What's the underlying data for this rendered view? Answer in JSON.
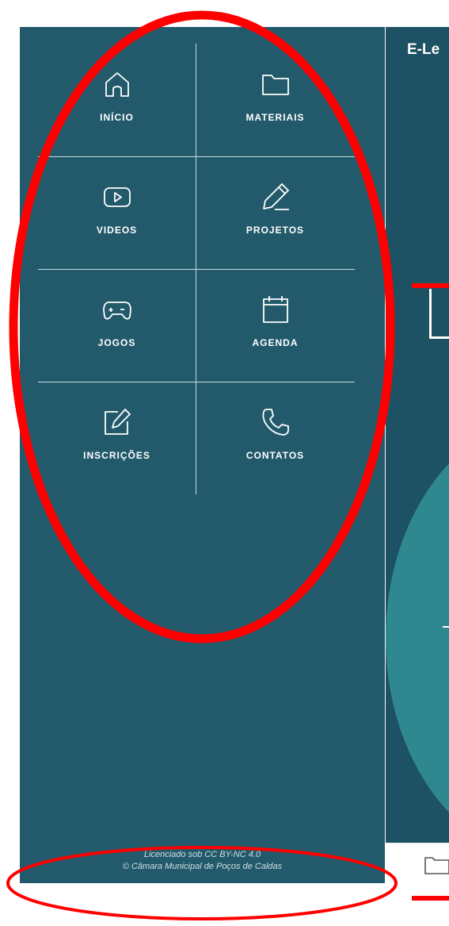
{
  "sidebar": {
    "menu": [
      {
        "label": "INÍCIO",
        "icon": "home-icon"
      },
      {
        "label": "MATERIAIS",
        "icon": "folder-icon"
      },
      {
        "label": "VIDEOS",
        "icon": "play-icon"
      },
      {
        "label": "PROJETOS",
        "icon": "pencil-icon"
      },
      {
        "label": "JOGOS",
        "icon": "gamepad-icon"
      },
      {
        "label": "AGENDA",
        "icon": "calendar-icon"
      },
      {
        "label": "INSCRIÇÕES",
        "icon": "edit-icon"
      },
      {
        "label": "CONTATOS",
        "icon": "phone-icon"
      }
    ],
    "footer": {
      "license": "Licenciado sob CC BY-NC 4.0",
      "copyright": "© Câmara Municipal de Poços de Caldas"
    }
  },
  "main": {
    "title": "E-Le"
  },
  "bottom_bar": {
    "icon": "folder-icon"
  },
  "colors": {
    "sidebar": "#225a6b",
    "main": "#1d5164",
    "accent": "#2f8890",
    "annotation": "#ff0000"
  }
}
